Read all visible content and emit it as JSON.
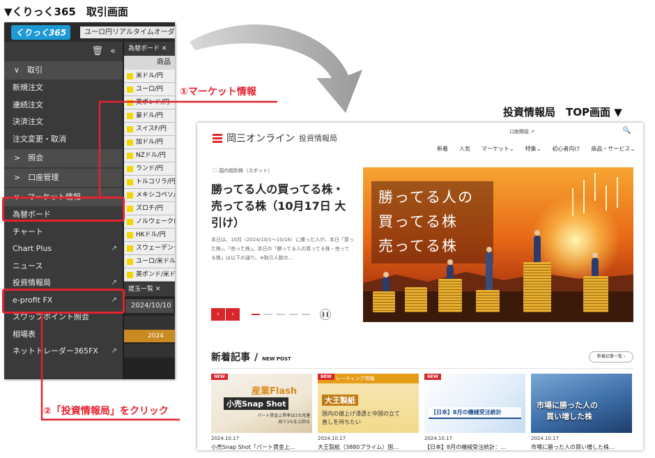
{
  "captions": {
    "left": "▼くりっく365　取引画面",
    "right": "投資情報局　TOP画面 ▼"
  },
  "trading_app": {
    "logo": "くりっく365",
    "ticker": "ユーロ円リアルタイムオーダ",
    "sidebar": {
      "group_torihiki": "取引",
      "items_torihiki": [
        "新規注文",
        "連続注文",
        "決済注文",
        "注文変更・取消"
      ],
      "group_shokai": "照会",
      "group_koza": "口座管理",
      "group_market": "マーケット情報",
      "items_market": [
        "為替ボード",
        "チャート",
        "Chart Plus",
        "ニュース",
        "投資情報局",
        "e-profit FX",
        "スワップポイント照会",
        "相場表",
        "ネットトレーダー365FX"
      ]
    },
    "panel": {
      "tab": "為替ボード",
      "header": "商品",
      "pairs": [
        "米ドル/円",
        "ユーロ/円",
        "英ポンド/円",
        "豪ドル/円",
        "スイスF/円",
        "加ドル/円",
        "NZドル/円",
        "ランド/円",
        "トルコリラ/円",
        "メキシコペソ/円",
        "ズロチ/円",
        "ノルウェークローネ/円",
        "HKドル/円",
        "スウェーデンクローナ/円",
        "ユーロ/米ドル",
        "英ポンド/米ドル"
      ],
      "tab2": "建玉一覧",
      "date": "2024/10/10",
      "orange_cell": "2024"
    }
  },
  "callouts": {
    "one": "①マーケット情報",
    "two": "②「投資情報局」をクリック"
  },
  "site": {
    "brand_name": "岡三オンライン",
    "brand_sub": "投資情報局",
    "account_link": "口座開設",
    "nav": [
      "新着",
      "人気",
      "マーケット",
      "特集",
      "初心者向け",
      "商品・サービス"
    ],
    "category": "国内個別株（スポット）",
    "headline": "勝ってる人の買ってる株・売ってる株（10月17日 大引け）",
    "excerpt": "本日は、10月（2024/10/1～10/16）に勝った人が、本日「買った株」、「売った株」。本日の「勝ってる人の買ってる株・売ってる株」は以下の通り。※取引人数の…",
    "hero_lines": [
      "勝ってる人の",
      "買ってる株",
      "売ってる株"
    ],
    "new_posts": {
      "title": "新着記事",
      "subtitle": "NEW POST",
      "list_button": "新着記事一覧",
      "badge": "NEW",
      "cards": [
        {
          "date": "2024.10.17",
          "title": "小売Snap Shot「パート賃金上…",
          "thumb_title": "産業Flash",
          "thumb_sub": "小売Snap Shot",
          "thumb_note": "パート賃金上昇率は3カ月連続で1%を上回る"
        },
        {
          "date": "2024.10.17",
          "title": "大王製紙（3880プライム）国…",
          "thumb_title": "レーティング情報",
          "thumb_sub": "大王製紙",
          "thumb_note": "国内の値上げ浸透と中国の立て直しを待ちたい"
        },
        {
          "date": "2024.10.17",
          "title": "【日本】8月の機械受注統計：…",
          "thumb_title": "【日本】8月の機械受注統計",
          "thumb_sub": "",
          "thumb_note": ""
        },
        {
          "date": "2024.10.17",
          "title": "市場に勝った人の買い増した株…",
          "thumb_title": "市場に勝った人の",
          "thumb_sub": "買い増した株",
          "thumb_note": ""
        }
      ]
    }
  },
  "colors": {
    "accent_red": "#e6222e",
    "brand_red": "#d7262c",
    "app_dark": "#3a3a3a"
  }
}
